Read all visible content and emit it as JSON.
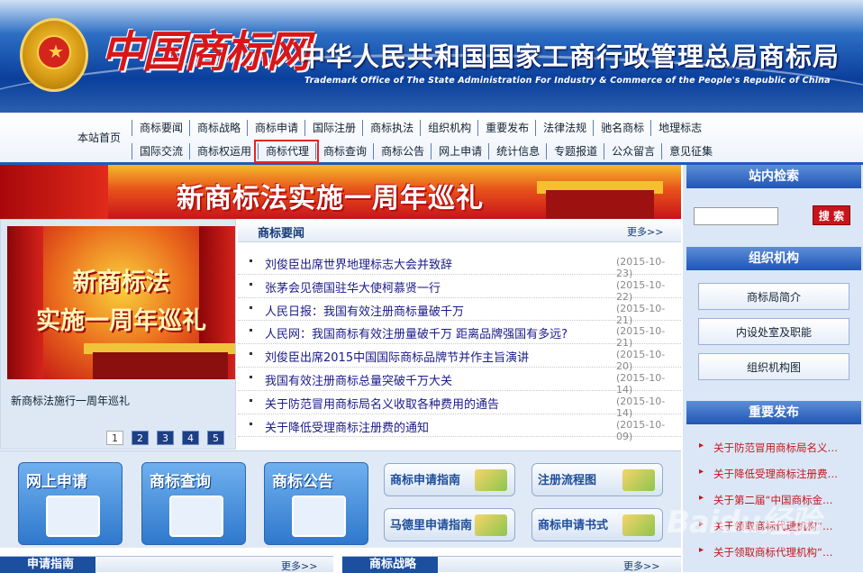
{
  "header": {
    "logo_text": "中国商标网",
    "bureau_name": "中华人民共和国国家工商行政管理总局商标局",
    "bureau_name_en": "Trademark Office of The State Administration For Industry & Commerce of the People's Republic of China"
  },
  "nav": {
    "home": "本站首页",
    "row1": [
      "商标要闻",
      "商标战略",
      "商标申请",
      "国际注册",
      "商标执法",
      "组织机构",
      "重要发布",
      "法律法规",
      "驰名商标",
      "地理标志"
    ],
    "row2": [
      "国际交流",
      "商标权运用",
      "商标代理",
      "商标查询",
      "商标公告",
      "网上申请",
      "统计信息",
      "专题报道",
      "公众留言",
      "意见征集"
    ],
    "active": "商标代理"
  },
  "banner": {
    "title": "新商标法实施一周年巡礼"
  },
  "featured": {
    "image_line1": "新商标法",
    "image_line2": "实施一周年巡礼",
    "caption": "新商标法施行一周年巡礼",
    "pages": [
      "1",
      "2",
      "3",
      "4",
      "5"
    ],
    "current_page": "1"
  },
  "news": {
    "title": "商标要闻",
    "more": "更多>>",
    "items": [
      {
        "title": "刘俊臣出席世界地理标志大会并致辞",
        "date": "(2015-10-23)"
      },
      {
        "title": "张茅会见德国驻华大使柯慕贤一行",
        "date": "(2015-10-22)"
      },
      {
        "title": "人民日报：我国有效注册商标量破千万",
        "date": "(2015-10-21)"
      },
      {
        "title": "人民网：我国商标有效注册量破千万 距离品牌强国有多远?",
        "date": "(2015-10-21)"
      },
      {
        "title": "刘俊臣出席2015中国国际商标品牌节并作主旨演讲",
        "date": "(2015-10-20)"
      },
      {
        "title": "我国有效注册商标总量突破千万大关",
        "date": "(2015-10-14)"
      },
      {
        "title": "关于防范冒用商标局名义收取各种费用的通告",
        "date": "(2015-10-14)"
      },
      {
        "title": "关于降低受理商标注册费的通知",
        "date": "(2015-10-09)"
      }
    ]
  },
  "sidebar": {
    "search_title": "站内检索",
    "search_value": "",
    "search_button": "搜 索",
    "org_title": "组织机构",
    "org_buttons": [
      "商标局简介",
      "内设处室及职能",
      "组织机构图"
    ],
    "release_title": "重要发布",
    "release_items": [
      "关于防范冒用商标局名义…",
      "关于降低受理商标注册费…",
      "关于第二届“中国商标金…",
      "关于领取商标代理机构“…",
      "关于领取商标代理机构“…"
    ]
  },
  "quick": {
    "tiles": [
      "网上申请",
      "商标查询",
      "商标公告"
    ],
    "guides": [
      "商标申请指南",
      "注册流程图",
      "马德里申请指南",
      "商标申请书式"
    ]
  },
  "bottom": {
    "left_tab": "申请指南",
    "left_more": "更多>>",
    "mid_tab": "商标战略",
    "mid_more": "更多>>"
  },
  "watermark": "Baidu经验",
  "colors": {
    "brand_blue": "#1f5bb8",
    "brand_red": "#d8161a",
    "link_red": "#c3151a"
  }
}
